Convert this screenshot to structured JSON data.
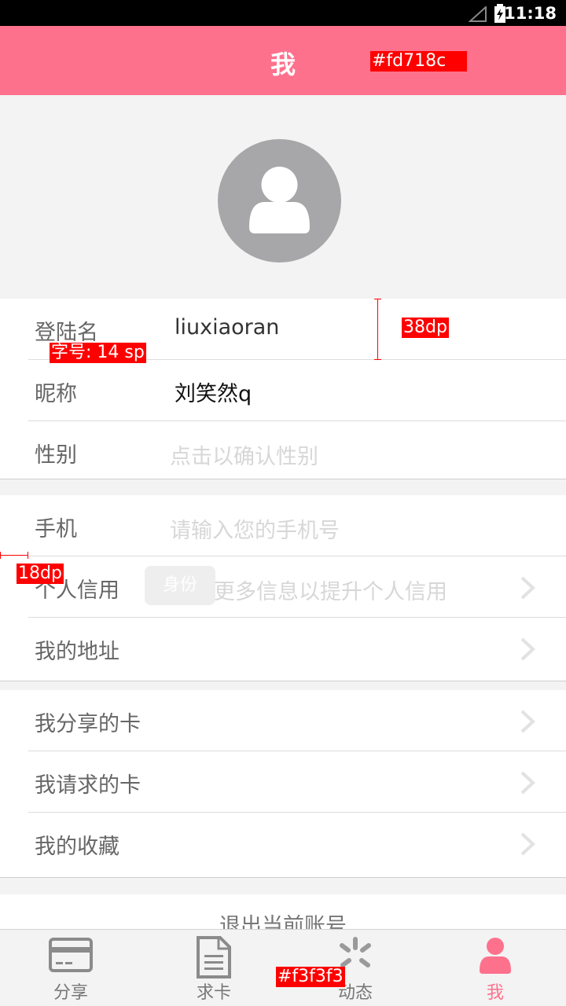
{
  "status_bar": {
    "time": "11:18"
  },
  "app_bar": {
    "title": "我"
  },
  "annotations": {
    "header_color": "#fd718c",
    "font_size": "字号: 14 sp",
    "row_height": "38dp",
    "left_margin": "18dp",
    "tab_bg": "#f3f3f3"
  },
  "profile": {
    "login_label": "登陆名",
    "login_value": "liuxiaoran",
    "nickname_label": "昵称",
    "nickname_value": "刘笑然q",
    "gender_label": "性别",
    "gender_placeholder": "点击以确认性别"
  },
  "contact": {
    "phone_label": "手机",
    "phone_placeholder": "请输入您的手机号",
    "credit_label": "个人信用",
    "credit_chip": "身份",
    "credit_hint": "更多信息以提升个人信用",
    "address_label": "我的地址"
  },
  "cards": {
    "shared_label": "我分享的卡",
    "requested_label": "我请求的卡",
    "favorites_label": "我的收藏"
  },
  "logout": {
    "label": "退出当前账号"
  },
  "tabs": [
    {
      "label": "分享",
      "icon": "card-icon"
    },
    {
      "label": "求卡",
      "icon": "document-icon"
    },
    {
      "label": "动态",
      "icon": "spinner-icon"
    },
    {
      "label": "我",
      "icon": "user-icon",
      "active": true
    }
  ],
  "colors": {
    "accent": "#fd718c",
    "background": "#f3f3f3"
  }
}
